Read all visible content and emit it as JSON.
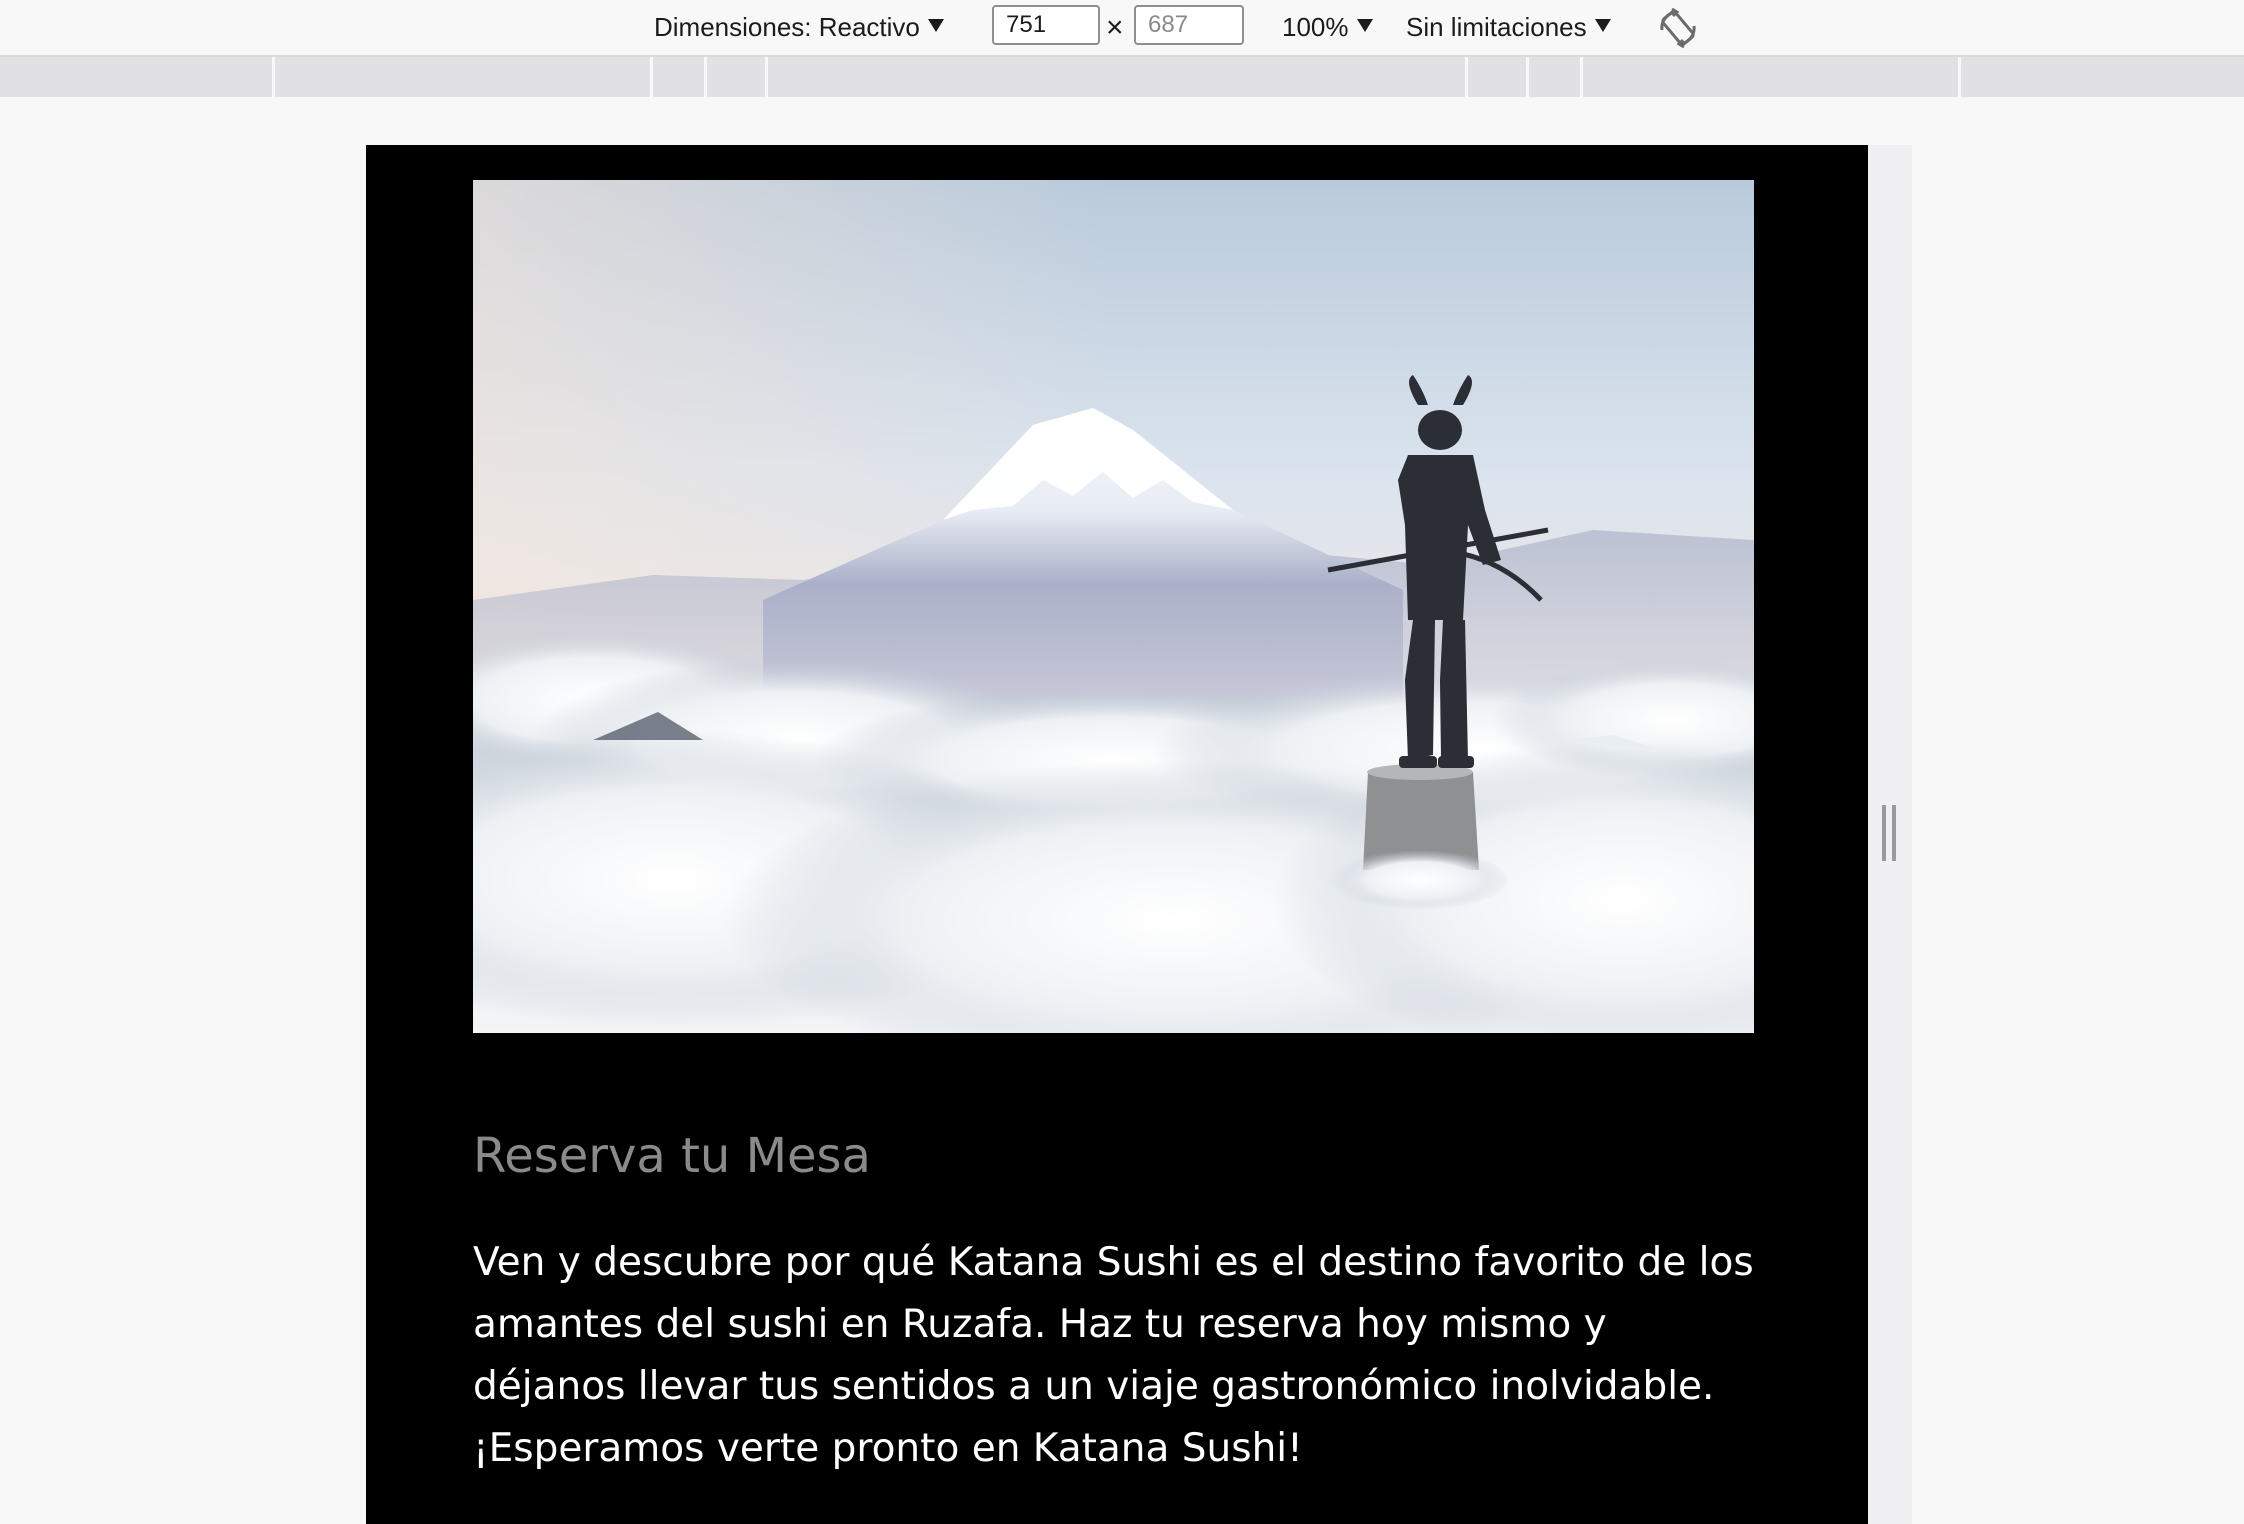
{
  "toolbar": {
    "dimensions_label": "Dimensiones: Reactivo",
    "width_value": "751",
    "height_placeholder": "687",
    "times_symbol": "×",
    "zoom_label": "100%",
    "throttle_label": "Sin limitaciones",
    "rotate_icon": "rotate-icon"
  },
  "page": {
    "heading": "Reserva tu Mesa",
    "paragraph": "Ven y descubre por qué Katana Sushi es el destino favorito de los amantes del sushi en Ruzafa. Haz tu reserva hoy mismo y déjanos llevar tus sentidos a un viaje gastronómico inolvidable. ¡Esperamos verte pronto en Katana Sushi!"
  },
  "colors": {
    "page_background": "#000000",
    "heading": "#8a8a8a",
    "text": "#ffffff",
    "chrome": "#f8f8f8"
  }
}
